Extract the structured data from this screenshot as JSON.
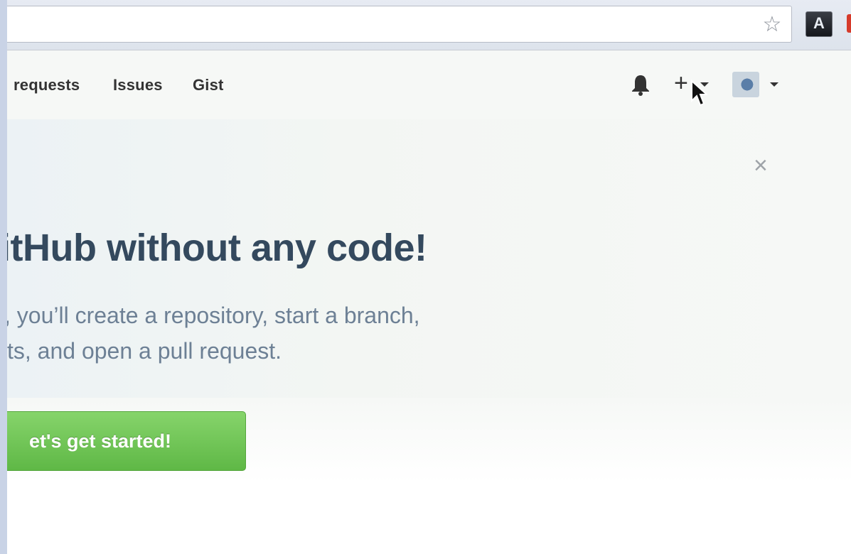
{
  "browser": {
    "bookmark_icon": "star-icon",
    "extension_label": "A"
  },
  "nav": {
    "links": [
      "requests",
      "Issues",
      "Gist"
    ],
    "notifications_icon": "bell-icon",
    "create_icon": "plus-icon",
    "avatar_menu_icon": "caret-down-icon"
  },
  "hero": {
    "close_label": "×",
    "title": "itHub without any code!",
    "description_lines": [
      ", you’ll create a repository, start a branch,",
      "ts, and open a pull request."
    ],
    "cta_label": "et's get started!"
  },
  "colors": {
    "title": "#34495e",
    "body_text": "#6d8095",
    "cta": "#6cc450"
  }
}
